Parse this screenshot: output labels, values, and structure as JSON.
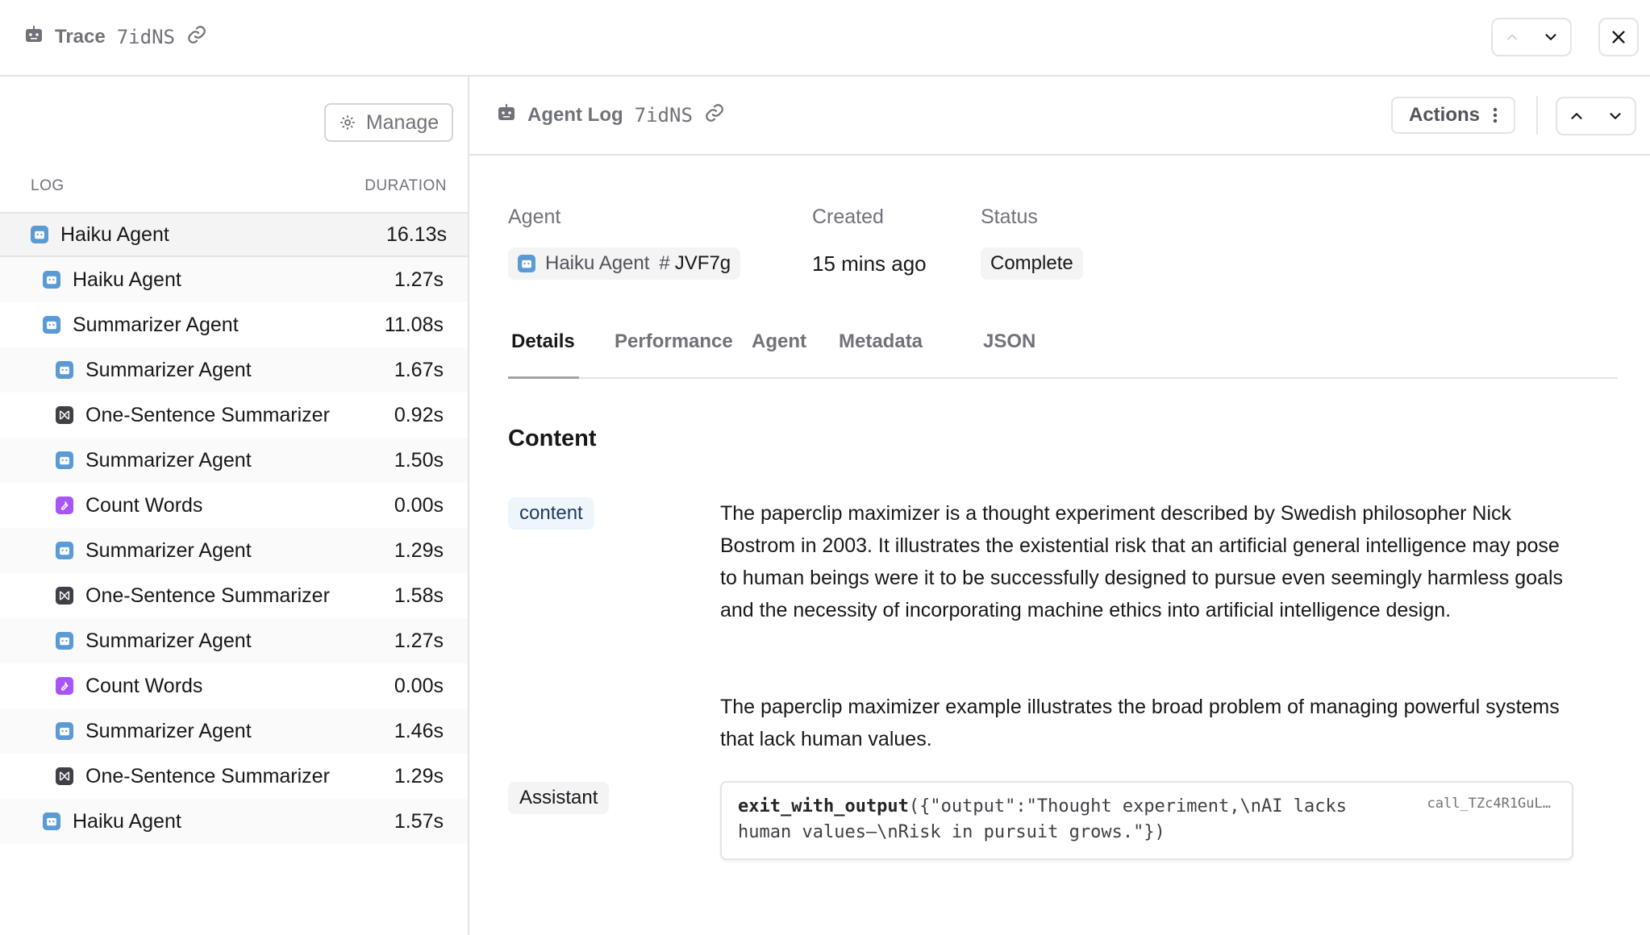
{
  "header": {
    "icon": "robot-icon",
    "title": "Trace",
    "id": "7idNS",
    "link_icon": "link-icon"
  },
  "sidebar": {
    "manage_label": "Manage",
    "col_log": "LOG",
    "col_duration": "DURATION",
    "rows": [
      {
        "label": "Haiku Agent",
        "duration": "16.13s",
        "type": "agent",
        "level": 0
      },
      {
        "label": "Haiku Agent",
        "duration": "1.27s",
        "type": "agent",
        "level": 1
      },
      {
        "label": "Summarizer Agent",
        "duration": "11.08s",
        "type": "agent",
        "level": 1
      },
      {
        "label": "Summarizer Agent",
        "duration": "1.67s",
        "type": "agent",
        "level": 2
      },
      {
        "label": "One-Sentence Summarizer",
        "duration": "0.92s",
        "type": "prompt",
        "level": 2
      },
      {
        "label": "Summarizer Agent",
        "duration": "1.50s",
        "type": "agent",
        "level": 2
      },
      {
        "label": "Count Words",
        "duration": "0.00s",
        "type": "tool",
        "level": 2
      },
      {
        "label": "Summarizer Agent",
        "duration": "1.29s",
        "type": "agent",
        "level": 2
      },
      {
        "label": "One-Sentence Summarizer",
        "duration": "1.58s",
        "type": "prompt",
        "level": 2
      },
      {
        "label": "Summarizer Agent",
        "duration": "1.27s",
        "type": "agent",
        "level": 2
      },
      {
        "label": "Count Words",
        "duration": "0.00s",
        "type": "tool",
        "level": 2
      },
      {
        "label": "Summarizer Agent",
        "duration": "1.46s",
        "type": "agent",
        "level": 2
      },
      {
        "label": "One-Sentence Summarizer",
        "duration": "1.29s",
        "type": "prompt",
        "level": 2
      },
      {
        "label": "Haiku Agent",
        "duration": "1.57s",
        "type": "agent",
        "level": 1
      }
    ]
  },
  "detail": {
    "title": "Agent Log",
    "id": "7idNS",
    "actions_label": "Actions",
    "meta": {
      "agent_label": "Agent",
      "agent_name": "Haiku Agent",
      "agent_hash": "#",
      "agent_version": "JVF7g",
      "created_label": "Created",
      "created_value": "15 mins ago",
      "status_label": "Status",
      "status_value": "Complete"
    },
    "tabs": [
      "Details",
      "Performance",
      "Agent",
      "Metadata",
      "JSON"
    ],
    "active_tab": "Details",
    "section_title": "Content",
    "content_tag": "content",
    "paragraph1": "The paperclip maximizer is a thought experiment described by Swedish philosopher Nick Bostrom in 2003. It illustrates the existential risk that an artificial general intelligence may pose to human beings were it to be successfully designed to pursue even seemingly harmless goals and the necessity of incorporating machine ethics into artificial intelligence design.",
    "paragraph2": "The paperclip maximizer example illustrates the broad problem of managing powerful systems that lack human values.",
    "assistant_tag": "Assistant",
    "tool_call": {
      "function": "exit_with_output",
      "args": "({\"output\":\"Thought experiment,\\nAI lacks human values—\\nRisk in pursuit grows.\"})",
      "call_id": "call_TZc4R1GuL…"
    }
  },
  "colors": {
    "agent_icon": "#5b9bd5",
    "prompt_icon": "#3f3f46",
    "tool_icon": "#a855f7",
    "content_tag_bg": "#eef6fb"
  }
}
